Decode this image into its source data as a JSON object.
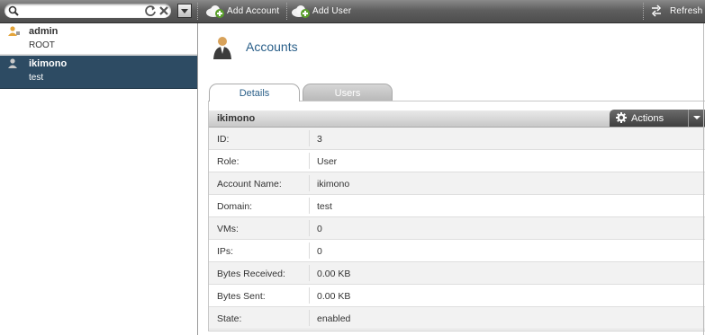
{
  "toolbar": {
    "search_placeholder": "",
    "add_account_label": "Add Account",
    "add_user_label": "Add User",
    "refresh_label": "Refresh"
  },
  "accounts": [
    {
      "name": "admin",
      "sub": "ROOT",
      "selected": false
    },
    {
      "name": "ikimono",
      "sub": "test",
      "selected": true
    }
  ],
  "page": {
    "title": "Accounts"
  },
  "tabs": [
    {
      "label": "Details",
      "active": true
    },
    {
      "label": "Users",
      "active": false
    }
  ],
  "detail": {
    "header": "ikimono",
    "actions_label": "Actions",
    "rows": [
      {
        "label": "ID:",
        "value": "3"
      },
      {
        "label": "Role:",
        "value": "User"
      },
      {
        "label": "Account Name:",
        "value": "ikimono"
      },
      {
        "label": "Domain:",
        "value": "test"
      },
      {
        "label": "VMs:",
        "value": "0"
      },
      {
        "label": "IPs:",
        "value": "0"
      },
      {
        "label": "Bytes Received:",
        "value": "0.00 KB"
      },
      {
        "label": "Bytes Sent:",
        "value": "0.00 KB"
      },
      {
        "label": "State:",
        "value": "enabled"
      }
    ]
  },
  "colors": {
    "selected_bg": "#2d4b63",
    "title_blue": "#2a5f89",
    "toolbar_dark": "#4d4d4d"
  }
}
